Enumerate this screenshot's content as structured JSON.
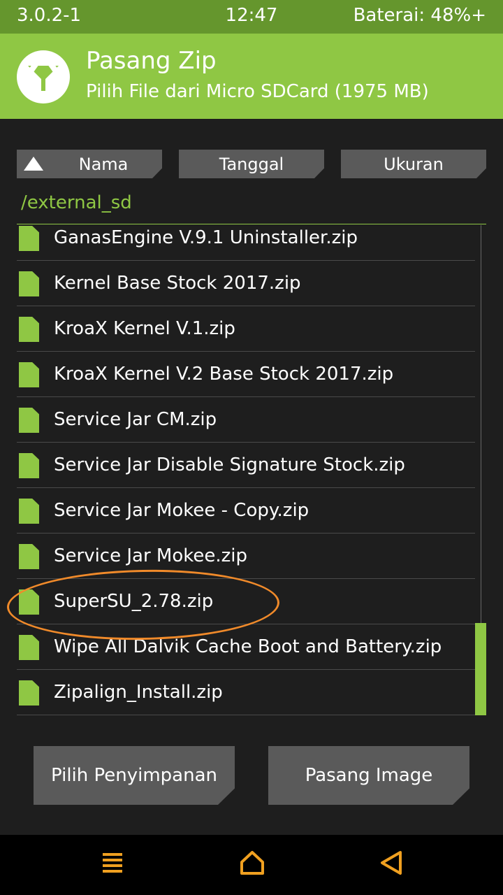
{
  "status_bar": {
    "version": "3.0.2-1",
    "time": "12:47",
    "battery": "Baterai: 48%+"
  },
  "header": {
    "logo_icon": "twrp-logo-icon",
    "title": "Pasang Zip",
    "subtitle": "Pilih File dari Micro SDCard (1975 MB)"
  },
  "sort": {
    "name_label": "Nama",
    "date_label": "Tanggal",
    "size_label": "Ukuran",
    "active_icon": "sort-ascending-triangle-icon"
  },
  "current_path": "/external_sd",
  "files": [
    "GanasEngine V.9.1 Uninstaller.zip",
    "Kernel Base Stock 2017.zip",
    "KroaX Kernel V.1.zip",
    "KroaX Kernel V.2 Base Stock 2017.zip",
    "Service Jar CM.zip",
    "Service Jar Disable Signature Stock.zip",
    "Service Jar Mokee - Copy.zip",
    "Service Jar Mokee.zip",
    "SuperSU_2.78.zip",
    "Wipe All Dalvik Cache Boot and Battery.zip",
    "Zipalign_Install.zip"
  ],
  "highlighted_file_index": 8,
  "actions": {
    "storage_label": "Pilih Penyimpanan",
    "image_label": "Pasang Image"
  },
  "nav": {
    "menu_icon": "menu-icon",
    "home_icon": "home-icon",
    "back_icon": "back-icon"
  },
  "colors": {
    "accent": "#8fc744",
    "status_bar": "#65962d",
    "nav_icon": "#f0a020",
    "highlight": "#f08a2a",
    "button": "#5a5a5a",
    "background": "#1e1e1e"
  }
}
